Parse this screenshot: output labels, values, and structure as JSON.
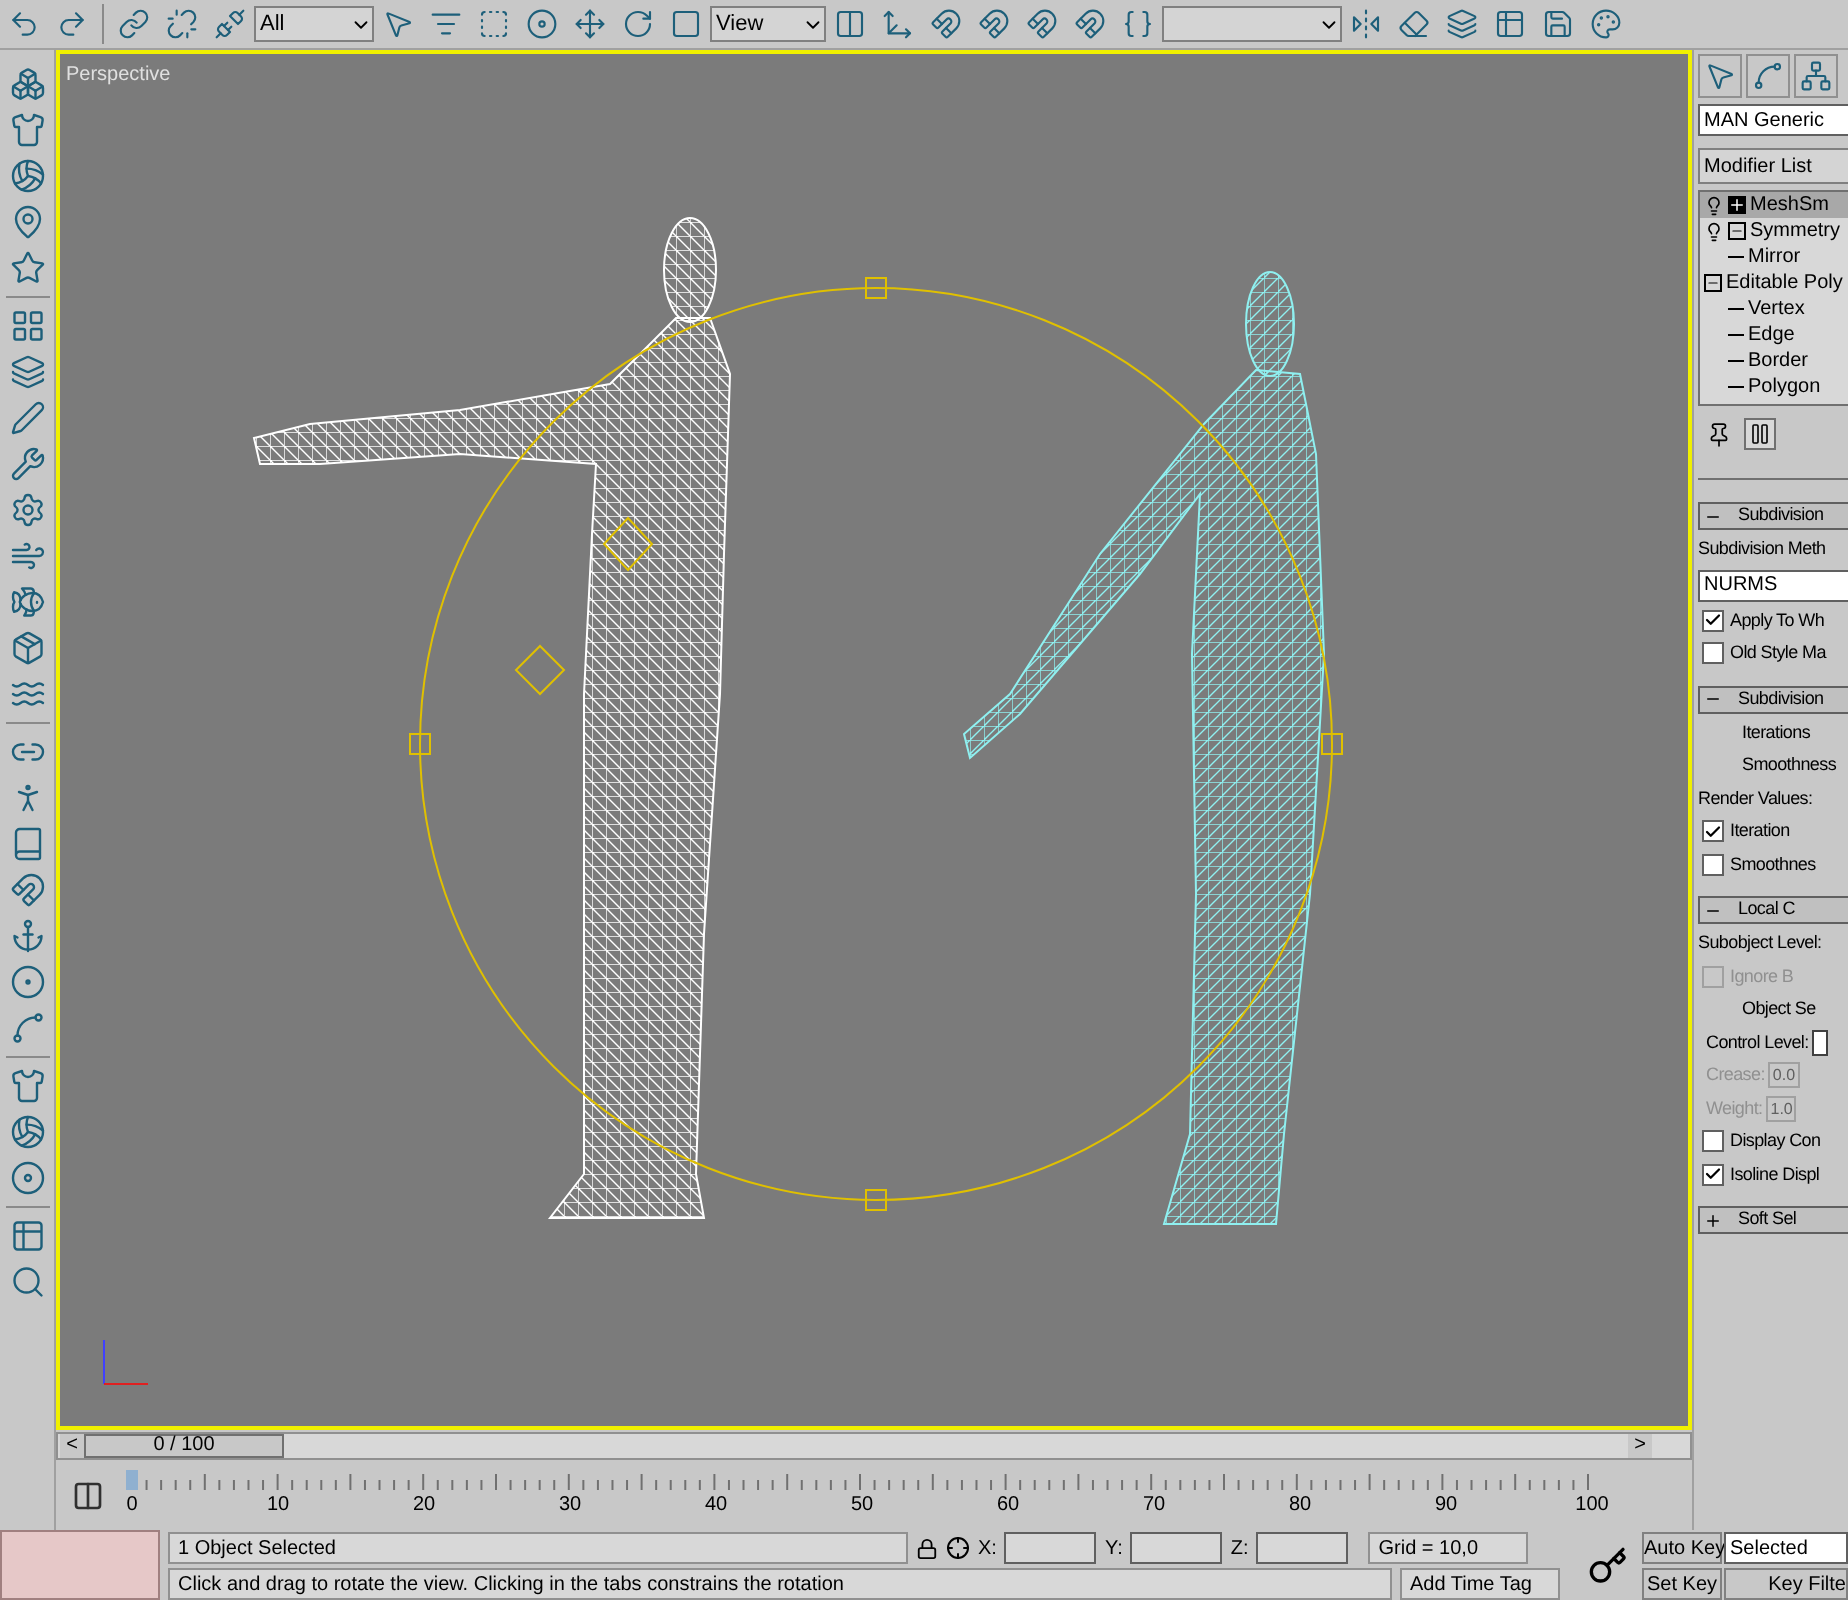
{
  "toolbar": {
    "selection_filter": "All",
    "reference_coord": "View"
  },
  "viewport": {
    "label": "Perspective"
  },
  "time_slider": {
    "prev": "<",
    "label": "0 / 100",
    "next": ">",
    "level": 0
  },
  "track_bar": {
    "ticks": [
      "0",
      "10",
      "20",
      "30",
      "40",
      "50",
      "60",
      "70",
      "80",
      "90",
      "100"
    ]
  },
  "command_panel": {
    "object_name": "MAN Generic",
    "modifier_list": "Modifier List",
    "stack": [
      {
        "label": "MeshSm",
        "kind": "modifier",
        "selected": true,
        "expanded": false
      },
      {
        "label": "Symmetry",
        "kind": "modifier",
        "selected": false,
        "expanded": true,
        "children": [
          {
            "label": "Mirror"
          }
        ]
      },
      {
        "label": "Editable Poly",
        "kind": "base",
        "selected": false,
        "expanded": true,
        "children": [
          {
            "label": "Vertex"
          },
          {
            "label": "Edge"
          },
          {
            "label": "Border"
          },
          {
            "label": "Polygon"
          }
        ]
      }
    ],
    "rollouts": [
      {
        "title": "Subdivision",
        "expanded": true,
        "controls": [
          {
            "kind": "text",
            "text": "Subdivision Meth"
          },
          {
            "kind": "dropdown",
            "value": "NURMS"
          },
          {
            "kind": "checkbox",
            "label": "Apply To Wh",
            "checked": true,
            "disabled": false
          },
          {
            "kind": "checkbox",
            "label": "Old Style Ma",
            "checked": false,
            "disabled": false
          }
        ]
      },
      {
        "title": "Subdivision",
        "expanded": true,
        "controls": [
          {
            "kind": "label",
            "text": "Iterations"
          },
          {
            "kind": "label",
            "text": "Smoothness"
          },
          {
            "kind": "text",
            "text": "Render Values:"
          },
          {
            "kind": "checkbox",
            "label": "Iteration",
            "checked": true,
            "disabled": false
          },
          {
            "kind": "checkbox",
            "label": "Smoothnes",
            "checked": false,
            "disabled": false
          }
        ]
      },
      {
        "title": "Local C",
        "expanded": true,
        "controls": [
          {
            "kind": "text",
            "text": "Subobject Level:"
          },
          {
            "kind": "checkbox",
            "label": "Ignore B",
            "checked": false,
            "disabled": true
          },
          {
            "kind": "label",
            "text": "Object Se"
          },
          {
            "kind": "field",
            "label": "Control Level:",
            "disabled": false
          },
          {
            "kind": "field",
            "label": "Crease:",
            "value": "0.0",
            "disabled": true
          },
          {
            "kind": "field",
            "label": "Weight:",
            "value": "1.0",
            "disabled": true
          },
          {
            "kind": "checkbox",
            "label": "Display Con",
            "checked": false,
            "disabled": false
          },
          {
            "kind": "checkbox",
            "label": "Isoline Displ",
            "checked": true,
            "disabled": false
          }
        ]
      },
      {
        "title": "Soft Sel",
        "expanded": false
      }
    ]
  },
  "status_bar": {
    "selection": "1 Object Selected",
    "x_label": "X:",
    "y_label": "Y:",
    "z_label": "Z:",
    "grid": "Grid = 10,0",
    "prompt": "Click and drag to rotate the view.  Clicking in the tabs constrains the rotation",
    "add_time_tag": "Add Time Tag",
    "auto_key": "Auto Key",
    "key_mode": "Selected",
    "set_key": "Set Key",
    "key_filters": "Key Filte"
  }
}
